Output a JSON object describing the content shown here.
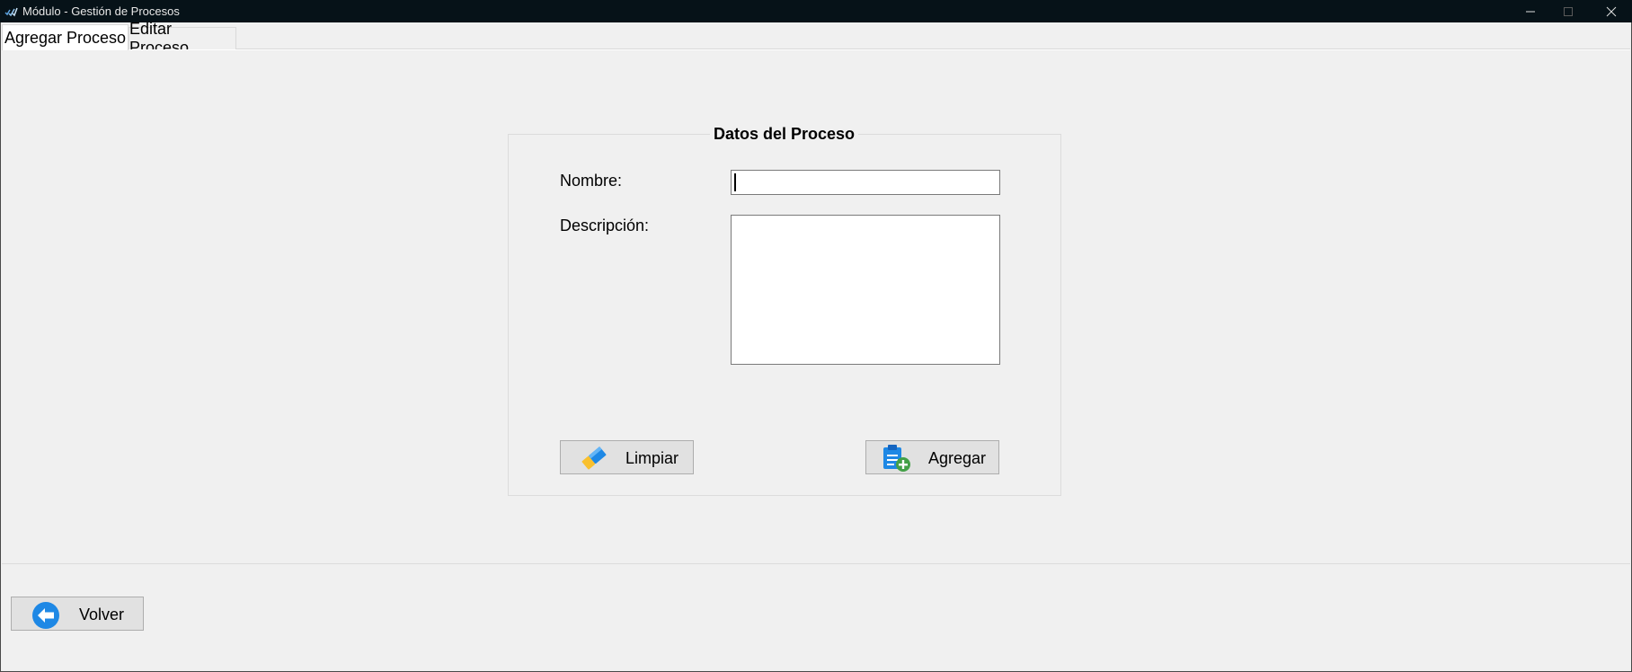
{
  "window": {
    "title": "Módulo - Gestión de Procesos",
    "icon": "app-checkmarks-icon",
    "controls": [
      "minimize-icon",
      "maximize-icon",
      "close-icon"
    ]
  },
  "tabs": [
    {
      "label": "Agregar Proceso",
      "active": true
    },
    {
      "label": "Editar Proceso",
      "active": false
    }
  ],
  "form": {
    "group_title": "Datos del Proceso",
    "nombre_label": "Nombre:",
    "nombre_value": "",
    "descripcion_label": "Descripción:",
    "descripcion_value": ""
  },
  "buttons": {
    "limpiar": {
      "label": "Limpiar",
      "icon": "eraser-icon"
    },
    "agregar": {
      "label": "Agregar",
      "icon": "clipboard-add-icon"
    },
    "volver": {
      "label": "Volver",
      "icon": "back-arrow-icon"
    }
  },
  "colors": {
    "titlebar": "#061218",
    "background": "#f0f0f0",
    "button": "#e1e1e1",
    "accent_blue": "#1e88e5",
    "accent_green": "#43a047"
  }
}
